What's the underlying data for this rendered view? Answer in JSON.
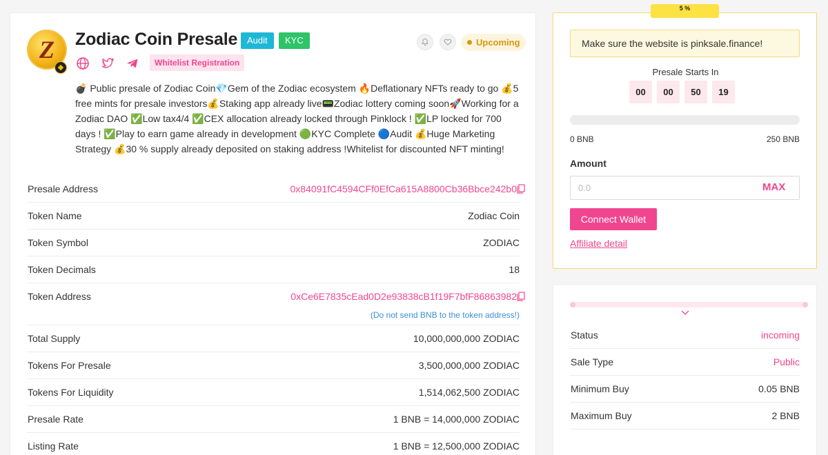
{
  "header": {
    "title": "Zodiac Coin Presale",
    "logo_letter": "Z",
    "tags": {
      "audit": "Audit",
      "kyc": "KYC"
    },
    "status": "Upcoming",
    "whitelist_label": "Whitelist Registration"
  },
  "description": "💣 Public presale of Zodiac Coin💎Gem of the Zodiac ecosystem 🔥Deflationary NFTs ready to go 💰5 free mints for presale investors💰Staking app already live📟Zodiac lottery coming soon🚀Working for a Zodiac DAO ✅Low tax4/4 ✅CEX allocation already locked through Pinklock ! ✅LP locked for 700 days ! ✅Play to earn game already in development 🟢KYC Complete 🔵Audit 💰Huge Marketing Strategy 💰30 % supply already deposited on staking address !Whitelist for discounted NFT minting!",
  "details": [
    {
      "label": "Presale Address",
      "value": "0x84091fC4594CFf0EfCa615A8800Cb36Bbce242b0",
      "link": true,
      "copy": true
    },
    {
      "label": "Token Name",
      "value": "Zodiac Coin"
    },
    {
      "label": "Token Symbol",
      "value": "ZODIAC"
    },
    {
      "label": "Token Decimals",
      "value": "18"
    },
    {
      "label": "Token Address",
      "value": "0xCe6E7835cEad0D2e93838cB1f19F7bfF86863982",
      "link": true,
      "copy": true,
      "note": "(Do not send BNB to the token address!)"
    },
    {
      "label": "Total Supply",
      "value": "10,000,000,000 ZODIAC"
    },
    {
      "label": "Tokens For Presale",
      "value": "3,500,000,000 ZODIAC"
    },
    {
      "label": "Tokens For Liquidity",
      "value": "1,514,062,500 ZODIAC"
    },
    {
      "label": "Presale Rate",
      "value": "1 BNB = 14,000,000 ZODIAC"
    },
    {
      "label": "Listing Rate",
      "value": "1 BNB = 12,500,000 ZODIAC"
    }
  ],
  "buy_panel": {
    "badge": "5 %",
    "alert": "Make sure the website is pinksale.finance!",
    "starts_label": "Presale Starts In",
    "countdown": [
      "00",
      "00",
      "50",
      "19"
    ],
    "progress": 0,
    "min_label": "0 BNB",
    "max_label": "250 BNB",
    "amount_label": "Amount",
    "amount_placeholder": "0.0",
    "max_button": "MAX",
    "connect_button": "Connect Wallet",
    "affiliate_link": "Affiliate detail"
  },
  "status_panel": {
    "rows": [
      {
        "label": "Status",
        "value": "incoming",
        "pink": true
      },
      {
        "label": "Sale Type",
        "value": "Public",
        "pink": true
      },
      {
        "label": "Minimum Buy",
        "value": "0.05 BNB"
      },
      {
        "label": "Maximum Buy",
        "value": "2 BNB"
      }
    ]
  },
  "colors": {
    "accent": "#f0468f",
    "warning": "#d59a0a",
    "audit": "#1fb7d6",
    "kyc": "#2fc36a",
    "badge": "#fde243"
  }
}
